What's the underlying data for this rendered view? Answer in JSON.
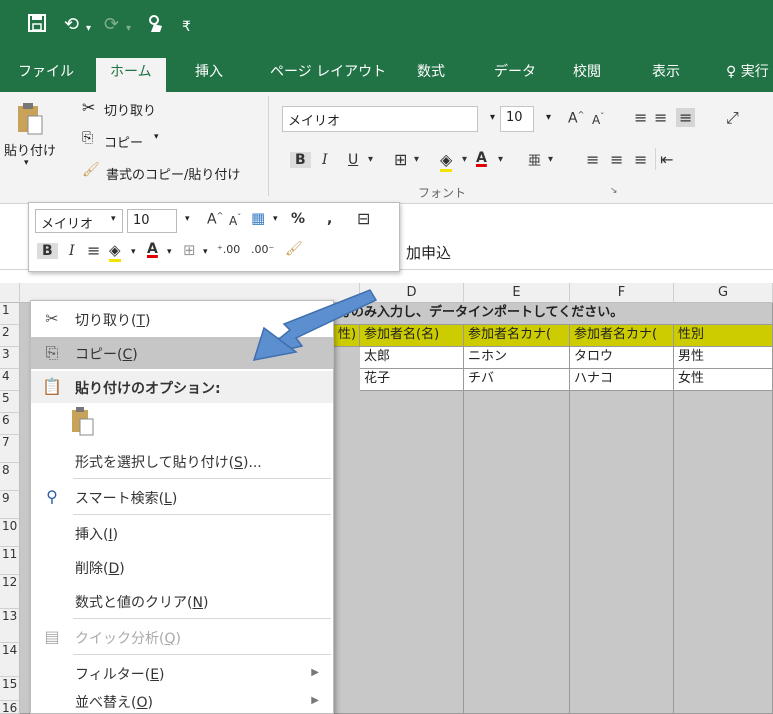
{
  "quick_access": {
    "save_icon": "save-icon",
    "undo_icon": "undo-icon",
    "redo_icon": "redo-icon",
    "touch_icon": "touch-mode-icon",
    "more_glyph": "₹"
  },
  "tabs": [
    {
      "label": "ファイル"
    },
    {
      "label": "ホーム"
    },
    {
      "label": "挿入"
    },
    {
      "label": "ページ レイアウト"
    },
    {
      "label": "数式"
    },
    {
      "label": "データ"
    },
    {
      "label": "校閲"
    },
    {
      "label": "表示"
    },
    {
      "label": "実行"
    }
  ],
  "clipboard": {
    "paste": "貼り付け",
    "cut": "切り取り",
    "copy": "コピー",
    "format_painter": "書式のコピー/貼り付け"
  },
  "font": {
    "name": "メイリオ",
    "size": "10",
    "group_label": "フォント",
    "bold": "B",
    "italic": "I",
    "underline": "U"
  },
  "mini_toolbar": {
    "font": "メイリオ",
    "size": "10",
    "percent": "%",
    "comma": ","
  },
  "formula_bar": {
    "content": "加申込"
  },
  "columns": [
    "D",
    "E",
    "F",
    "G"
  ],
  "rows": [
    "1",
    "2",
    "3",
    "4",
    "5",
    "6",
    "7",
    "8",
    "9",
    "10",
    "11",
    "12",
    "13",
    "14",
    "15",
    "16"
  ],
  "row1_text": "方のみ入力し、データインポートしてください。",
  "header_row": [
    "性)",
    "参加者名(名)",
    "参加者名カナ(",
    "参加者名カナ(",
    "性別"
  ],
  "data_rows": [
    [
      "太郎",
      "ニホン",
      "タロウ",
      "男性"
    ],
    [
      "花子",
      "チバ",
      "ハナコ",
      "女性"
    ]
  ],
  "context_menu": [
    {
      "label": "切り取り(",
      "key": "T",
      "tail": ")",
      "icon": "scissors-icon"
    },
    {
      "label": "コピー(",
      "key": "C",
      "tail": ")",
      "icon": "copy-icon"
    },
    {
      "label": "貼り付けのオプション:",
      "key": "",
      "tail": "",
      "icon": "paste-icon"
    },
    {
      "label": "形式を選択して貼り付け(",
      "key": "S",
      "tail": ")...",
      "icon": ""
    },
    {
      "label": "スマート検索(",
      "key": "L",
      "tail": ")",
      "icon": "smart-lookup-icon"
    },
    {
      "label": "挿入(",
      "key": "I",
      "tail": ")",
      "icon": ""
    },
    {
      "label": "削除(",
      "key": "D",
      "tail": ")",
      "icon": ""
    },
    {
      "label": "数式と値のクリア(",
      "key": "N",
      "tail": ")",
      "icon": ""
    },
    {
      "label": "クイック分析(",
      "key": "Q",
      "tail": ")",
      "icon": "quick-analysis-icon"
    },
    {
      "label": "フィルター(",
      "key": "E",
      "tail": ")",
      "icon": ""
    },
    {
      "label": "並べ替え(",
      "key": "O",
      "tail": ")",
      "icon": ""
    }
  ],
  "colors": {
    "accent": "#217346",
    "highlight_arrow": "#5b8fd0",
    "header_fill": "#cccc00",
    "selected_fill": "#c8c8c8"
  }
}
